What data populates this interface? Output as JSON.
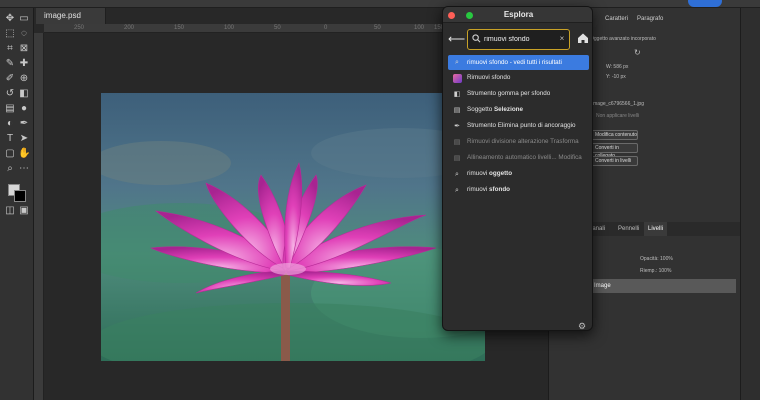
{
  "document": {
    "tab_label": "image.psd"
  },
  "ruler": {
    "ticks": [
      "250",
      "200",
      "150",
      "100",
      "50",
      "0",
      "50",
      "100",
      "150"
    ]
  },
  "right_panel": {
    "tabs": [
      "Caratteri",
      "Paragrafo"
    ],
    "prop_title": "Oggetto avanzato incorporato",
    "w_label": "W: 586 px",
    "x_label": "X:",
    "h_label": "Y: -10 px",
    "file_name": "image_c6796566_1.jpg",
    "comps": "Non applicare livelli",
    "buttons": [
      "Modifica contenuto",
      "Converti in collegato",
      "Converti in livelli"
    ],
    "layers_tabs": [
      "Canali",
      "Pennelli",
      "Livelli"
    ],
    "opacity_label": "Opacità: 100%",
    "fill_label": "Riemp.: 100%",
    "selected_layer": "Image"
  },
  "dialog": {
    "title": "Esplora",
    "search_value": "rimuovi sfondo",
    "clear_glyph": "×",
    "results": [
      {
        "id": "all",
        "text": "rimuovi sfondo - vedi tutti i risultati",
        "icon": "search-icon",
        "highlight": true,
        "dim": false
      },
      {
        "id": "rimuovi-sfondo-app",
        "text": "Rimuovi sfondo",
        "icon": "app-thumb-icon",
        "highlight": false,
        "dim": false
      },
      {
        "id": "gomma",
        "text": "Strumento gomma per sfondo",
        "icon": "eraser-icon",
        "highlight": false,
        "dim": false
      },
      {
        "id": "soggetto",
        "pre": "Soggetto ",
        "bold": "Selezione",
        "icon": "document-icon",
        "highlight": false,
        "dim": false
      },
      {
        "id": "elimina-punto",
        "text": "Strumento Elimina punto di ancoraggio",
        "icon": "pen-minus-icon",
        "highlight": false,
        "dim": false
      },
      {
        "id": "divisione",
        "text": "Rimuovi divisione alterazione Trasforma",
        "icon": "document-icon",
        "highlight": false,
        "dim": true
      },
      {
        "id": "allineamento",
        "text": "Allineamento automatico livelli... Modifica",
        "icon": "document-icon",
        "highlight": false,
        "dim": true
      },
      {
        "id": "oggetto",
        "pre": "rimuovi ",
        "bold": "oggetto",
        "icon": "search-icon",
        "highlight": false,
        "dim": false
      },
      {
        "id": "sfondo",
        "pre": "rimuovi ",
        "bold": "sfondo",
        "icon": "search-icon",
        "highlight": false,
        "dim": false
      }
    ]
  },
  "colors": {
    "accent_blue": "#3b7be0",
    "search_outline": "#c9a227",
    "flower_pink": "#e13fb7"
  }
}
